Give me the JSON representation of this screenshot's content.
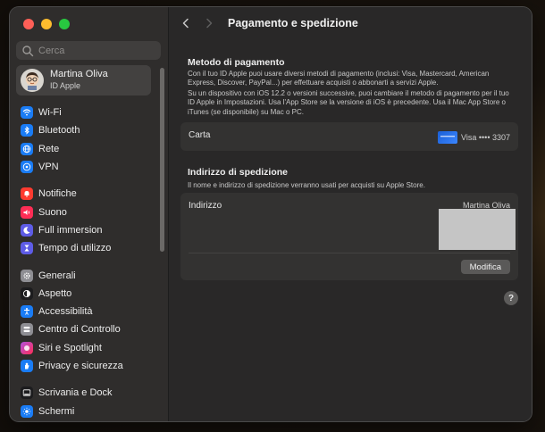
{
  "window": {
    "title": "Pagamento e spedizione"
  },
  "search": {
    "placeholder": "Cerca"
  },
  "profile": {
    "name": "Martina Oliva",
    "subtitle": "ID Apple"
  },
  "sidebar": {
    "groups": [
      [
        {
          "label": "Wi-Fi",
          "icon": "wifi-icon",
          "color": "#1a7cf5"
        },
        {
          "label": "Bluetooth",
          "icon": "bluetooth-icon",
          "color": "#1a7cf5"
        },
        {
          "label": "Rete",
          "icon": "globe-icon",
          "color": "#1a7cf5"
        },
        {
          "label": "VPN",
          "icon": "vpn-icon",
          "color": "#1a7cf5"
        }
      ],
      [
        {
          "label": "Notifiche",
          "icon": "bell-icon",
          "color": "#ff3b30"
        },
        {
          "label": "Suono",
          "icon": "speaker-icon",
          "color": "#ff2d55"
        },
        {
          "label": "Full immersion",
          "icon": "moon-icon",
          "color": "#5e5ce6"
        },
        {
          "label": "Tempo di utilizzo",
          "icon": "hourglass-icon",
          "color": "#5e5ce6"
        }
      ],
      [
        {
          "label": "Generali",
          "icon": "gear-icon",
          "color": "#8e8e93"
        },
        {
          "label": "Aspetto",
          "icon": "appearance-icon",
          "color": "#1c1c1e"
        },
        {
          "label": "Accessibilità",
          "icon": "accessibility-icon",
          "color": "#1a7cf5"
        },
        {
          "label": "Centro di Controllo",
          "icon": "control-center-icon",
          "color": "#8e8e93"
        },
        {
          "label": "Siri e Spotlight",
          "icon": "siri-icon",
          "color": "#af52de"
        },
        {
          "label": "Privacy e sicurezza",
          "icon": "hand-icon",
          "color": "#1a7cf5"
        }
      ],
      [
        {
          "label": "Scrivania e Dock",
          "icon": "dock-icon",
          "color": "#1c1c1e"
        },
        {
          "label": "Schermi",
          "icon": "sun-icon",
          "color": "#1a7cf5"
        }
      ]
    ]
  },
  "payment": {
    "title": "Metodo di pagamento",
    "desc1": "Con il tuo ID Apple puoi usare diversi metodi di pagamento (inclusi: Visa, Mastercard, American Express, Discover, PayPal...) per effettuare acquisti o abbonarti a servizi Apple.",
    "desc2": "Su un dispositivo con iOS 12.2 o versioni successive, puoi cambiare il metodo di pagamento per il tuo ID Apple in Impostazioni. Usa l'App Store se la versione di iOS è precedente. Usa il Mac App Store o iTunes (se disponibile) su Mac o PC.",
    "card_label": "Carta",
    "card_value": "Visa •••• 3307"
  },
  "shipping": {
    "title": "Indirizzo di spedizione",
    "desc": "Il nome e indirizzo di spedizione verranno usati per acquisti su Apple Store.",
    "address_label": "Indirizzo",
    "address_name": "Martina Oliva",
    "edit_label": "Modifica"
  },
  "help": {
    "label": "?"
  }
}
